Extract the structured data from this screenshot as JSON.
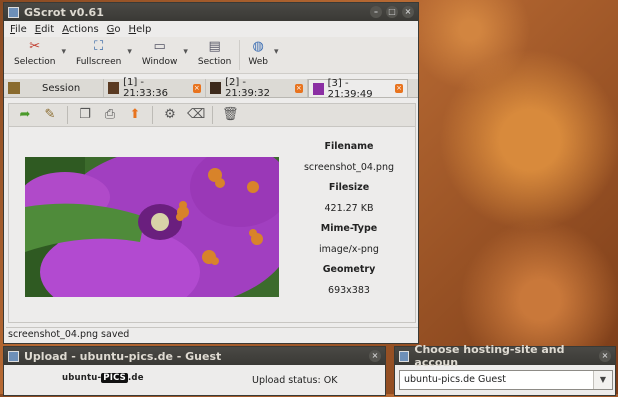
{
  "main_window": {
    "title": "GScrot v0.61",
    "menu": [
      "File",
      "Edit",
      "Actions",
      "Go",
      "Help"
    ],
    "toolbar": [
      {
        "label": "Selection",
        "icon": "scissors-icon"
      },
      {
        "label": "Fullscreen",
        "icon": "fullscreen-icon"
      },
      {
        "label": "Window",
        "icon": "window-icon"
      },
      {
        "label": "Section",
        "icon": "section-icon"
      },
      {
        "label": "Web",
        "icon": "globe-icon"
      }
    ],
    "tabs": [
      {
        "label": "Session"
      },
      {
        "label": "[1] - 21:33:36"
      },
      {
        "label": "[2] - 21:39:32"
      },
      {
        "label": "[3] - 21:39:49"
      }
    ],
    "image_info": {
      "filename_label": "Filename",
      "filename": "screenshot_04.png",
      "filesize_label": "Filesize",
      "filesize": "421.27 KB",
      "mimetype_label": "Mime-Type",
      "mimetype": "image/x-png",
      "geometry_label": "Geometry",
      "geometry": "693x383"
    },
    "status": "screenshot_04.png saved"
  },
  "upload_window": {
    "title": "Upload - ubuntu-pics.de - Guest",
    "logo_prefix": "ubuntu-",
    "logo_mid": "PICS",
    "logo_suffix": ".de",
    "status": "Upload status: OK"
  },
  "hosting_window": {
    "title": "Choose hosting-site and accoun",
    "selected": "ubuntu-pics.de Guest"
  },
  "colors": {
    "accent": "#e8731e",
    "titlebar": "#3a3935"
  }
}
